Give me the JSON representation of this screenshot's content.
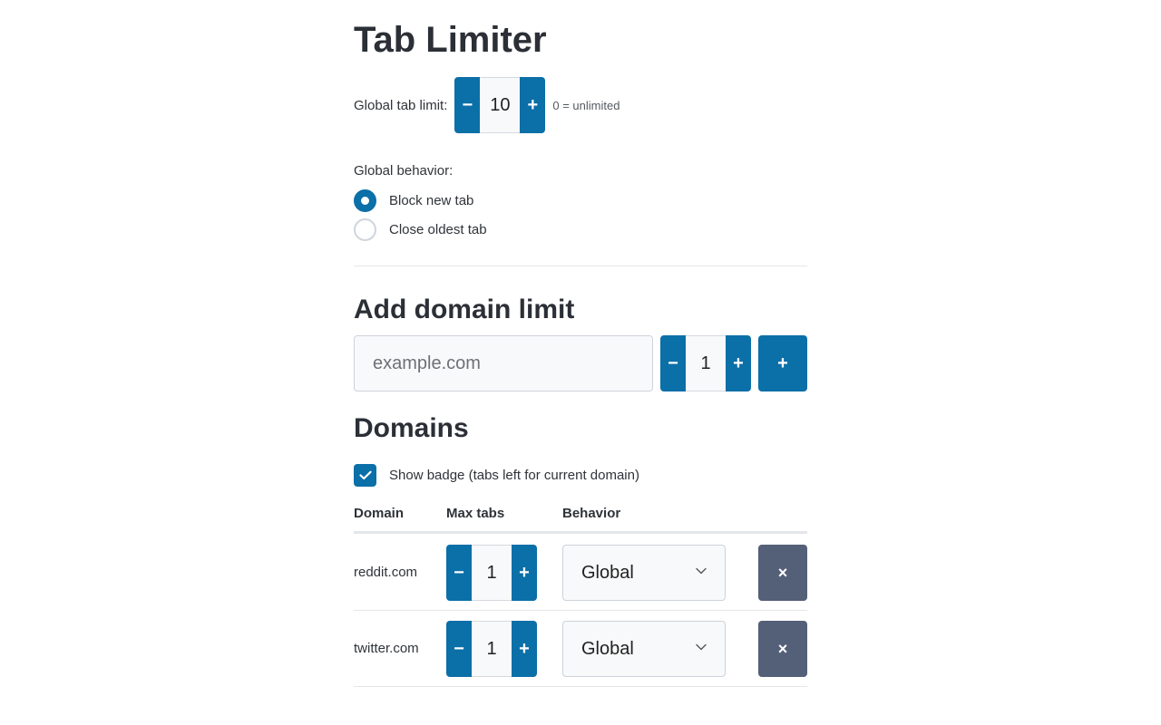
{
  "page": {
    "title": "Tab Limiter"
  },
  "global": {
    "limit_label": "Global tab limit:",
    "limit_value": "10",
    "decrement_symbol": "−",
    "increment_symbol": "+",
    "hint": "0 = unlimited",
    "behavior_label": "Global behavior:",
    "behavior_options": [
      {
        "label": "Block new tab",
        "selected": true
      },
      {
        "label": "Close oldest tab",
        "selected": false
      }
    ]
  },
  "add_domain": {
    "heading": "Add domain limit",
    "input_placeholder": "example.com",
    "input_value": "",
    "limit_value": "1",
    "add_symbol": "+"
  },
  "domains": {
    "heading": "Domains",
    "show_badge_label": "Show badge (tabs left for current domain)",
    "show_badge_checked": true,
    "columns": [
      "Domain",
      "Max tabs",
      "Behavior"
    ],
    "rows": [
      {
        "domain": "reddit.com",
        "max_tabs": "1",
        "behavior": "Global",
        "remove_symbol": "×"
      },
      {
        "domain": "twitter.com",
        "max_tabs": "1",
        "behavior": "Global",
        "remove_symbol": "×"
      }
    ]
  },
  "colors": {
    "accent": "#0b6fa8",
    "remove_button": "#545f78",
    "divider": "#e3e6ea"
  },
  "icons": {
    "check": "check-icon",
    "chevron": "chevron-down-icon",
    "remove": "close-icon"
  }
}
